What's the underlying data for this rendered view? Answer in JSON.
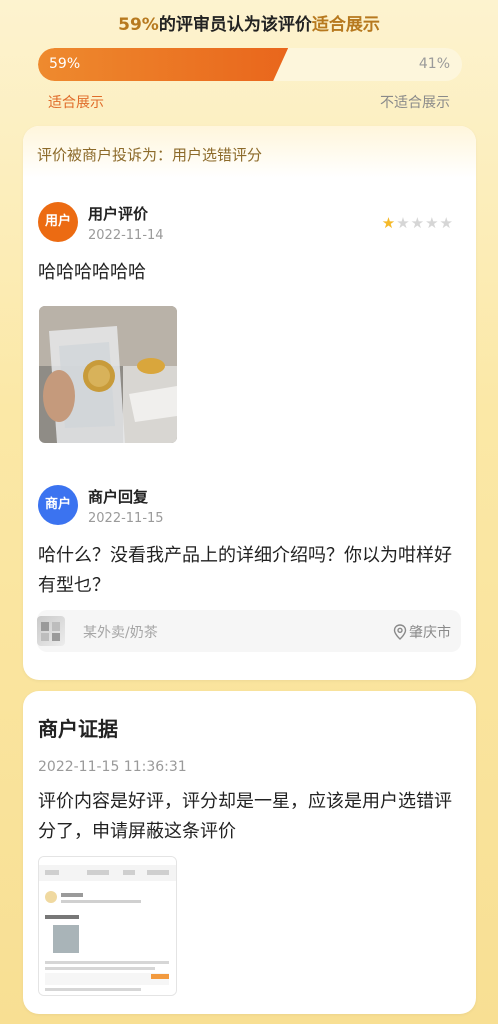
{
  "vote": {
    "percent_text": "59%",
    "header_middle": "的评审员认为该评价",
    "header_accent": "适合展示",
    "left_pct": "59%",
    "right_pct": "41%",
    "approve_fraction": 0.59,
    "left_label": "适合展示",
    "right_label": "不适合展示"
  },
  "complaint": {
    "banner": "评价被商户投诉为：用户选错评分"
  },
  "review": {
    "avatar_label": "用户",
    "title": "用户评价",
    "date": "2022-11-14",
    "rating": 1,
    "rating_max": 5,
    "content": "哈哈哈哈哈哈"
  },
  "reply": {
    "avatar_label": "商户",
    "title": "商户回复",
    "date": "2022-11-15",
    "content": "哈什么？没看我产品上的详细介绍吗？你以为咁样好有型乜？"
  },
  "shop": {
    "name": "某外卖/奶茶",
    "location": "肇庆市"
  },
  "evidence": {
    "title": "商户证据",
    "timestamp": "2022-11-15 11:36:31",
    "content": "评价内容是好评，评分却是一星，应该是用户选错评分了，申请屏蔽这条评价"
  },
  "colors": {
    "accent_orange": "#ec6b12",
    "merchant_blue": "#3b73f0",
    "star_gold": "#f5b928"
  },
  "icons": {
    "location": "location-pin-icon",
    "star": "star-icon"
  }
}
